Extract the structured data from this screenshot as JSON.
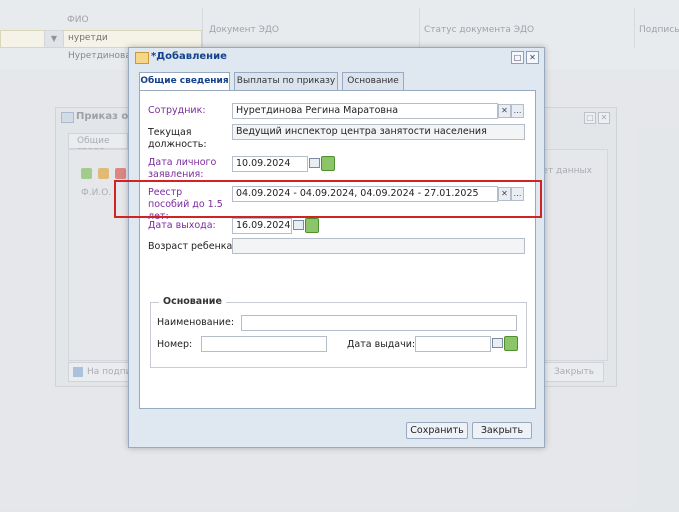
{
  "background": {
    "columns": [
      "ФИО",
      "Документ ЭДО",
      "Статус документа ЭДО",
      "Подпись"
    ],
    "filter_value": "нуретди",
    "row_value": "Нуретдинова Р"
  },
  "underlying_window": {
    "title": "Приказ об о",
    "tab": "Общие сведе",
    "column_fio": "Ф.И.О.",
    "no_data": "Нет данных",
    "sign_button": "На подпись",
    "close_button": "Закрыть"
  },
  "dialog": {
    "title": "*Добавление",
    "tabs": [
      "Общие сведения",
      "Выплаты по приказу",
      "Основание"
    ],
    "employee_label": "Сотрудник:",
    "employee_value": "Нуретдинова Регина Маратовна",
    "position_label": "Текущая должность:",
    "position_value": "Ведущий инспектор центра занятости населения",
    "application_date_label": "Дата личного заявления:",
    "application_date_value": "10.09.2024",
    "registry_label": "Реестр пособий до 1.5 лет:",
    "registry_value": "04.09.2024 - 04.09.2024, 04.09.2024 - 27.01.2025",
    "exit_date_label": "Дата выхода:",
    "exit_date_value": "16.09.2024",
    "child_age_label": "Возраст ребенка:",
    "child_age_value": "",
    "basis_group_title": "Основание",
    "name_label": "Наименование:",
    "number_label": "Номер:",
    "issue_date_label": "Дата выдачи:",
    "save_button": "Сохранить",
    "close_button": "Закрыть"
  },
  "colors": {
    "highlight": "#d02424",
    "label_purple": "#7b2c9e",
    "title_blue": "#15428b"
  }
}
